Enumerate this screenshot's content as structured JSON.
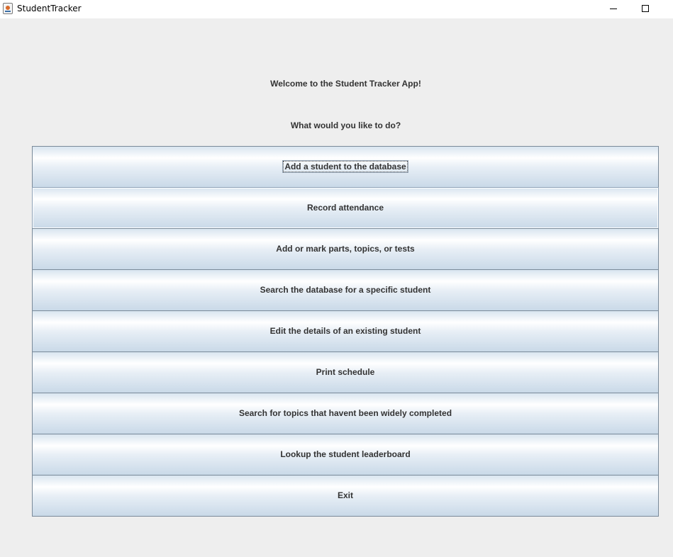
{
  "window": {
    "title": "StudentTracker"
  },
  "header": {
    "welcome": "Welcome to the Student Tracker App!",
    "prompt": "What would you like to do?"
  },
  "menu": {
    "buttons": [
      {
        "label": "Add a student to the database"
      },
      {
        "label": "Record attendance"
      },
      {
        "label": "Add or mark parts, topics, or tests"
      },
      {
        "label": "Search the database for a specific student"
      },
      {
        "label": "Edit the details of an existing student"
      },
      {
        "label": "Print schedule"
      },
      {
        "label": "Search for topics that havent been widely completed"
      },
      {
        "label": "Lookup the student leaderboard"
      },
      {
        "label": "Exit"
      }
    ]
  },
  "icons": {
    "app": "java-app-icon",
    "minimize": "minimize-icon",
    "maximize": "maximize-icon"
  },
  "colors": {
    "background": "#eeeeee",
    "button_border": "#7a8a99",
    "button_gradient_top": "#ffffff",
    "button_gradient_bottom": "#c9d9e8",
    "text": "#333333"
  }
}
